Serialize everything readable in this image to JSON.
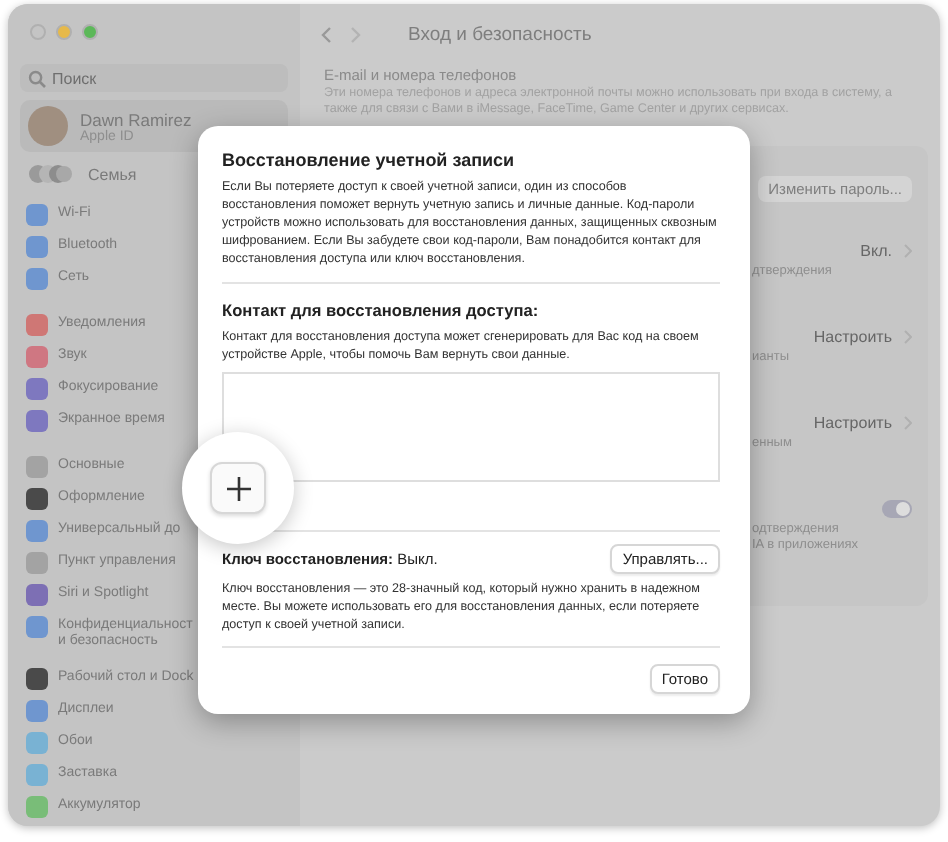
{
  "sidebar": {
    "search": {
      "placeholder": "Поиск"
    },
    "account": {
      "name": "Dawn Ramirez",
      "subtitle": "Apple ID"
    },
    "family": {
      "label": "Семья"
    },
    "groups": [
      [
        {
          "label": "Wi-Fi",
          "color": "#6f96cf"
        },
        {
          "label": "Bluetooth",
          "color": "#6f96cf"
        },
        {
          "label": "Сеть",
          "color": "#6f96cf"
        }
      ],
      [
        {
          "label": "Уведомления",
          "color": "#cf7775"
        },
        {
          "label": "Звук",
          "color": "#cf7782"
        },
        {
          "label": "Фокусирование",
          "color": "#7e78bf"
        },
        {
          "label": "Экранное время",
          "color": "#7e78bf"
        }
      ],
      [
        {
          "label": "Основные",
          "color": "#a3a3a3"
        },
        {
          "label": "Оформление",
          "color": "#4a4a4a"
        },
        {
          "label": "Универсальный до",
          "color": "#6f96cf"
        },
        {
          "label": "Пункт управления",
          "color": "#a3a3a3"
        },
        {
          "label": "Siri и Spotlight",
          "color": "#7d6fb4"
        },
        {
          "label": "Конфиденциальност и безопасность",
          "color": "#6f96cf"
        }
      ],
      [
        {
          "label": "Рабочий стол и Dock",
          "color": "#4a4a4a"
        },
        {
          "label": "Дисплеи",
          "color": "#6f96cf"
        },
        {
          "label": "Обои",
          "color": "#79b2d3"
        },
        {
          "label": "Заставка",
          "color": "#79b2d3"
        },
        {
          "label": "Аккумулятор",
          "color": "#79bd78"
        }
      ]
    ]
  },
  "main": {
    "title": "Вход и безопасность",
    "section": {
      "heading": "E-mail и номера телефонов",
      "description": "Эти номера телефонов и адреса электронной почты можно использовать при входа в систему, а также для связи с Вами в iMessage, FaceTime, Game Center и других сервисах."
    },
    "rows": [
      {
        "kind": "button",
        "label": "Изменить пароль..."
      },
      {
        "kind": "value",
        "value": "Вкл.",
        "fragments": [
          "дтверждения"
        ]
      },
      {
        "kind": "value",
        "value": "Настроить",
        "fragments": [
          "ианты"
        ]
      },
      {
        "kind": "value",
        "value": "Настроить",
        "fragments": [
          "енным"
        ]
      },
      {
        "kind": "toggle",
        "on": true,
        "fragments": [
          "одтверждения",
          "IA в приложениях"
        ]
      }
    ]
  },
  "dialog": {
    "title": "Восстановление учетной записи",
    "intro": "Если Вы потеряете доступ к своей учетной записи, один из способов восстановления поможет вернуть учетную запись и личные данные. Код-пароли устройств можно использовать для восстановления данных, защищенных сквозным шифрованием. Если Вы забудете свои код-пароли, Вам понадобится контакт для восстановления доступа или ключ восстановления.",
    "contact": {
      "heading": "Контакт для восстановления доступа:",
      "description": "Контакт для восстановления доступа может сгенерировать для Вас код на своем устройстве Apple, чтобы помочь Вам вернуть свои данные."
    },
    "key": {
      "label": "Ключ восстановления:",
      "status": "Выкл.",
      "button": "Управлять...",
      "description": "Ключ восстановления — это 28-значный код, который нужно хранить в надежном месте. Вы можете использовать его для восстановления данных, если потеряете доступ к своей учетной записи."
    },
    "done": "Готово"
  }
}
